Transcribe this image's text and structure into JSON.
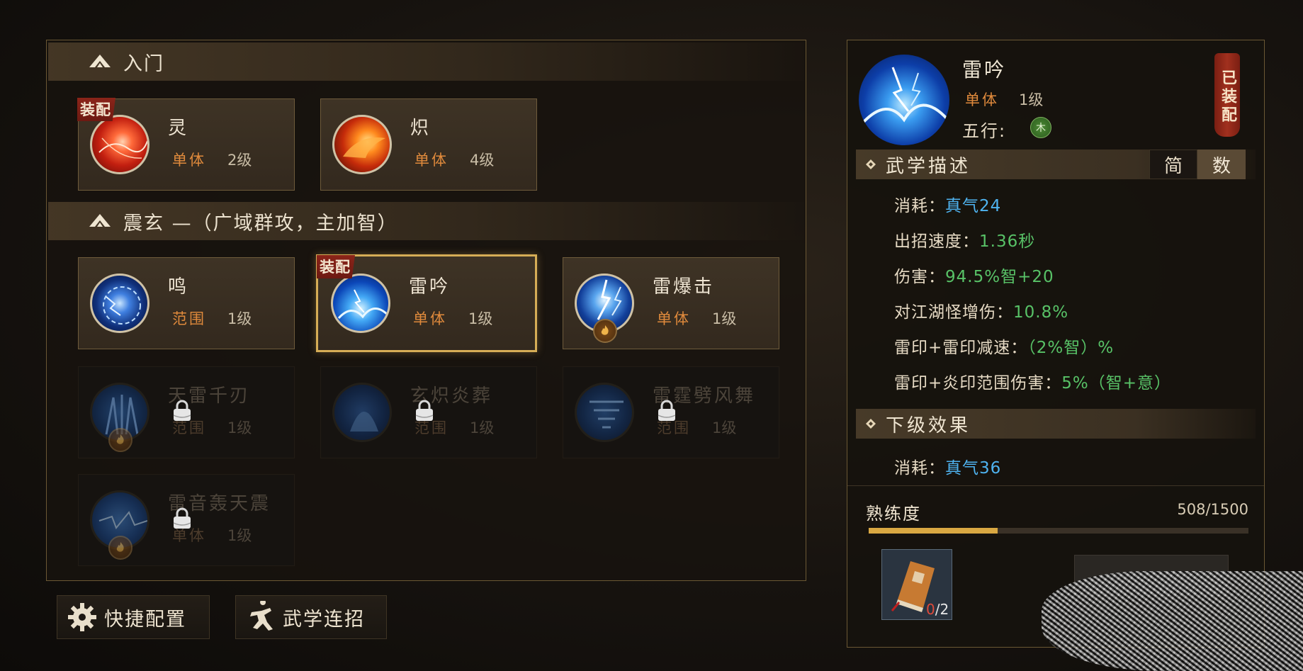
{
  "left_panel": {
    "sections": [
      {
        "title": "入门"
      },
      {
        "title": "震玄 —（广域群攻，主加智）"
      }
    ],
    "cards": [
      {
        "name": "灵",
        "type": "单体",
        "level": "2级",
        "tag": "装配",
        "icon": "spirit-orb-icon"
      },
      {
        "name": "炽",
        "type": "单体",
        "level": "4级",
        "icon": "fire-orb-icon"
      },
      {
        "name": "鸣",
        "type": "范围",
        "level": "1级",
        "icon": "thunder-ring-icon"
      },
      {
        "name": "雷吟",
        "type": "单体",
        "level": "1级",
        "tag": "装配",
        "icon": "thunder-wave-icon"
      },
      {
        "name": "雷爆击",
        "type": "单体",
        "level": "1级",
        "icon": "lightning-burst-icon"
      },
      {
        "name": "天雷千刃",
        "type": "范围",
        "level": "1级",
        "locked": true,
        "icon": "thunder-blades-icon"
      },
      {
        "name": "玄炽炎葬",
        "type": "范围",
        "level": "1级",
        "locked": true,
        "icon": "dark-flame-icon"
      },
      {
        "name": "雷霆劈风舞",
        "type": "范围",
        "level": "1级",
        "locked": true,
        "icon": "tornado-icon"
      },
      {
        "name": "雷音轰天震",
        "type": "单体",
        "level": "1级",
        "locked": true,
        "icon": "thunder-quake-icon"
      }
    ],
    "buttons": {
      "quick_config": "快捷配置",
      "combo": "武学连招"
    }
  },
  "detail": {
    "name": "雷吟",
    "type": "单体",
    "level": "1级",
    "wuxing_label": "五行:",
    "wuxing_value": "木",
    "equipped": "已装配",
    "description_title": "武学描述",
    "toggle_simple": "简",
    "toggle_numeric": "数",
    "stats": [
      {
        "label": "消耗：",
        "value": "真气24",
        "color": "blue"
      },
      {
        "label": "出招速度：",
        "value": "1.36秒",
        "color": "green"
      },
      {
        "label": "伤害：",
        "value": "94.5%智+20",
        "color": "green"
      },
      {
        "label": "对江湖怪增伤：",
        "value": "10.8%",
        "color": "green"
      },
      {
        "label": "雷印+雷印减速：",
        "value": "（2%智）%",
        "color": "green"
      },
      {
        "label": "雷印+炎印范围伤害：",
        "value": "5%（智+意）",
        "color": "green"
      }
    ],
    "next_level_title": "下级效果",
    "next_stats": [
      {
        "label": "消耗：",
        "value": "真气36",
        "color": "blue"
      }
    ],
    "proficiency_label": "熟练度",
    "proficiency_value": "508/1500",
    "proficiency_fraction": 0.339,
    "book_count_have": "0",
    "book_count_need": "/2"
  },
  "colors": {
    "accent_gold": "#d6ad56",
    "skill_type": "#e08a3c",
    "stat_blue": "#4fb3f0",
    "stat_green": "#58c267",
    "equip_red": "#8b2419"
  }
}
